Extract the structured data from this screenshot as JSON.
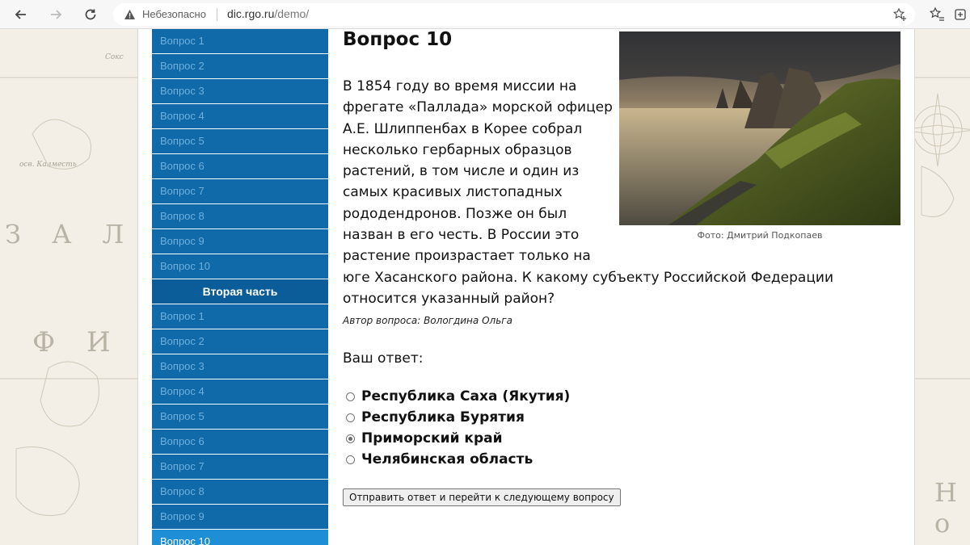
{
  "browser": {
    "security_label": "Небезопасно",
    "url_host": "dic.rgo.ru",
    "url_path": "/demo/"
  },
  "sidebar": {
    "part1_items": [
      {
        "label": "Вопрос 1"
      },
      {
        "label": "Вопрос 2"
      },
      {
        "label": "Вопрос 3"
      },
      {
        "label": "Вопрос 4"
      },
      {
        "label": "Вопрос 5"
      },
      {
        "label": "Вопрос 6"
      },
      {
        "label": "Вопрос 7"
      },
      {
        "label": "Вопрос 8"
      },
      {
        "label": "Вопрос 9"
      },
      {
        "label": "Вопрос 10"
      }
    ],
    "part2_heading": "Вторая часть",
    "part2_items": [
      {
        "label": "Вопрос 1"
      },
      {
        "label": "Вопрос 2"
      },
      {
        "label": "Вопрос 3"
      },
      {
        "label": "Вопрос 4"
      },
      {
        "label": "Вопрос 5"
      },
      {
        "label": "Вопрос 6"
      },
      {
        "label": "Вопрос 7"
      },
      {
        "label": "Вопрос 8"
      },
      {
        "label": "Вопрос 9"
      },
      {
        "label": "Вопрос 10"
      }
    ],
    "active_color": "#1e8fd6",
    "item_color": "#1069a8"
  },
  "question": {
    "title": "Вопрос 10",
    "text": "В 1854 году во время миссии на фрегате «Паллада» морской офицер А.Е. Шлиппенбах в Корее собрал несколько гербарных образцов растений, в том числе и один из самых красивых листопадных рододендронов. Позже он был назван в его честь. В России это растение произрастает только на юге Хасанского района. К какому субъекту Российской Федерации относится указанный район?",
    "author": "Автор вопроса: Вологдина Ольга",
    "photo_caption": "Фото: Дмитрий Подкопаев"
  },
  "answer": {
    "label": "Ваш ответ:",
    "options": [
      {
        "label": "Республика Саха (Якутия)",
        "checked": false
      },
      {
        "label": "Республика Бурятия",
        "checked": false
      },
      {
        "label": "Приморский край",
        "checked": true
      },
      {
        "label": "Челябинская область",
        "checked": false
      }
    ],
    "submit_label": "Отправить ответ и перейти к следующему вопросу"
  },
  "map": {
    "labels": [
      "З А Л И",
      "Ф И Н",
      "Н о"
    ],
    "small_labels": [
      "осв. Калместь",
      "Сокс"
    ]
  }
}
